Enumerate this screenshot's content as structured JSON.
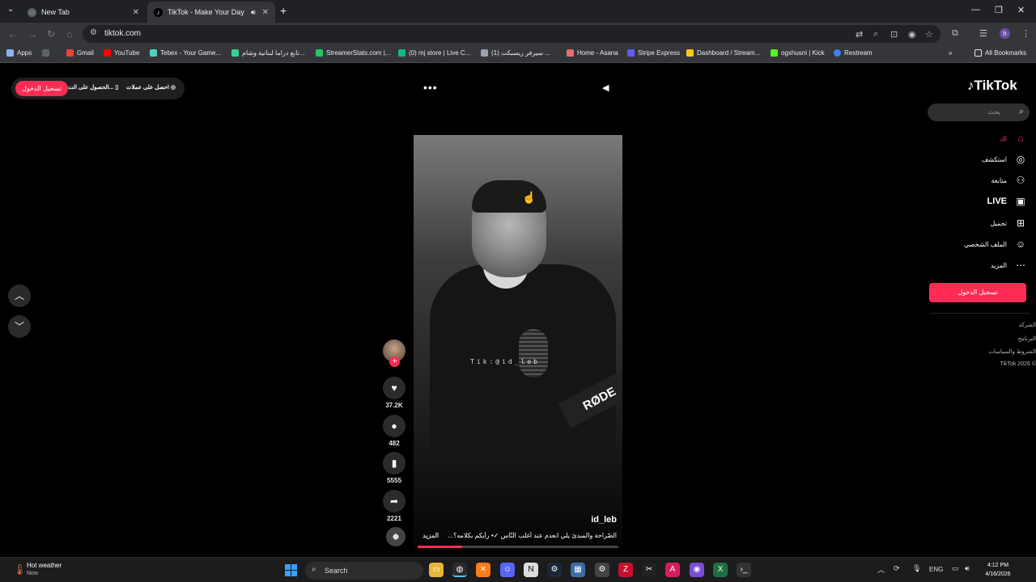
{
  "browser": {
    "tabs": [
      {
        "label": "New Tab",
        "active": false
      },
      {
        "label": "TikTok - Make Your Day",
        "active": true
      }
    ],
    "url": "tiktok.com",
    "profile_initial": "h",
    "bookmarks": [
      {
        "label": "Apps",
        "color": "#8ab4f8"
      },
      {
        "label": "Gmail",
        "color": "#ea4335"
      },
      {
        "label": "YouTube",
        "color": "#ff0000"
      },
      {
        "label": "Tebex - Your Game...",
        "color": "#4fd1c5"
      },
      {
        "label": "تابع دراما لبنانية وشام...",
        "color": "#34d399"
      },
      {
        "label": "StreamerStats.com |...",
        "color": "#22c55e"
      },
      {
        "label": "(0) mj store | Live C...",
        "color": "#10b981"
      },
      {
        "label": "(1) سيرفر ريسبكت ...",
        "color": "#9ca3af"
      },
      {
        "label": "Home - Asana",
        "color": "#f06a6a"
      },
      {
        "label": "Stripe Express",
        "color": "#635bff"
      },
      {
        "label": "Dashboard / Stream...",
        "color": "#facc15"
      },
      {
        "label": "ogxhusni | Kick",
        "color": "#53fc18"
      },
      {
        "label": "Restream",
        "color": "#3b82f6"
      }
    ],
    "all_bookmarks": "All Bookmarks"
  },
  "tiktok": {
    "top_pill": {
      "login": "تسجيل الدخول",
      "get_app": "الحصول على الت...",
      "get_coins": "احصل على عملات"
    },
    "logo": "TikTok",
    "search_placeholder": "بحث",
    "nav": [
      {
        "label": "لك",
        "icon": "home-icon",
        "glyph": "⌂"
      },
      {
        "label": "استكشف",
        "icon": "compass-icon",
        "glyph": "◎"
      },
      {
        "label": "متابعة",
        "icon": "following-icon",
        "glyph": "⚇"
      },
      {
        "label": "LIVE",
        "icon": "live-icon",
        "glyph": "▣"
      },
      {
        "label": "تحميل",
        "icon": "upload-icon",
        "glyph": "⊞"
      },
      {
        "label": "الملف الشخصي",
        "icon": "profile-icon",
        "glyph": "☺"
      },
      {
        "label": "المزيد",
        "icon": "more-icon",
        "glyph": "⋯"
      }
    ],
    "side_login": "تسجيل الدخول",
    "footer_links": [
      "الشركة",
      "البرنامج",
      "الشروط والسياسات",
      "TikTok 2026 ©"
    ],
    "video": {
      "watermark": "Tik:@id_leb",
      "brand_text": "RØDE",
      "username": "id_leb",
      "caption": "الصّراحة والمبدئ يلي انعدم عند أغلب النّاس ✓• رأيكم بكلامه؟...",
      "more": "المزيد",
      "progress": 0.22
    },
    "actions": {
      "likes": "37.2K",
      "comments": "482",
      "saves": "5555",
      "shares": "2221"
    }
  },
  "taskbar": {
    "weather_title": "Hot weather",
    "weather_sub": "Now",
    "search": "Search",
    "lang": "ENG",
    "time": "4:12 PM",
    "date": "4/16/2026"
  }
}
